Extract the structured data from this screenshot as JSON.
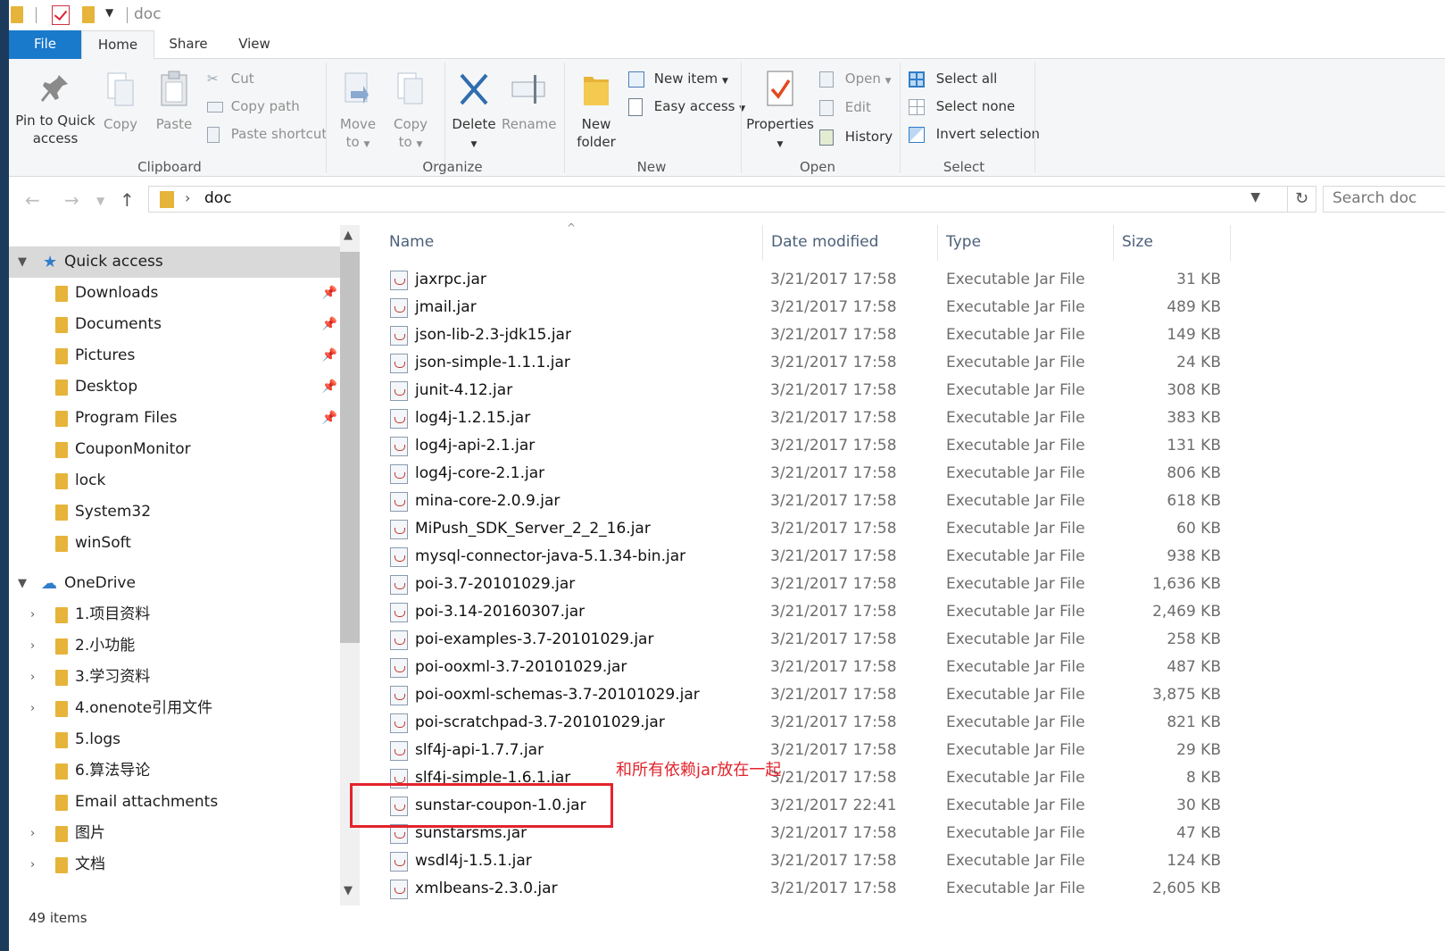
{
  "window": {
    "title": "doc"
  },
  "ribbon_tabs": [
    "File",
    "Home",
    "Share",
    "View"
  ],
  "ribbon": {
    "clipboard": {
      "group": "Clipboard",
      "pin_l1": "Pin to Quick",
      "pin_l2": "access",
      "copy": "Copy",
      "paste": "Paste",
      "cut": "Cut",
      "copy_path": "Copy path",
      "paste_shortcut": "Paste shortcut"
    },
    "organize": {
      "group": "Organize",
      "move_l1": "Move",
      "move_l2": "to",
      "copy_l1": "Copy",
      "copy_l2": "to",
      "delete": "Delete",
      "rename": "Rename"
    },
    "new": {
      "group": "New",
      "new_folder_l1": "New",
      "new_folder_l2": "folder",
      "new_item": "New item",
      "easy_access": "Easy access"
    },
    "open": {
      "group": "Open",
      "properties": "Properties",
      "open": "Open",
      "edit": "Edit",
      "history": "History"
    },
    "select": {
      "group": "Select",
      "select_all": "Select all",
      "select_none": "Select none",
      "invert_selection": "Invert selection"
    }
  },
  "address": {
    "path": "doc",
    "search_placeholder": "Search doc"
  },
  "navpane": {
    "quick_access": "Quick access",
    "quick_items": [
      {
        "label": "Downloads",
        "pinned": true
      },
      {
        "label": "Documents",
        "pinned": true
      },
      {
        "label": "Pictures",
        "pinned": true
      },
      {
        "label": "Desktop",
        "pinned": true
      },
      {
        "label": "Program Files",
        "pinned": true
      },
      {
        "label": "CouponMonitor",
        "pinned": false
      },
      {
        "label": "lock",
        "pinned": false
      },
      {
        "label": "System32",
        "pinned": false
      },
      {
        "label": "winSoft",
        "pinned": false
      }
    ],
    "onedrive": "OneDrive",
    "onedrive_items": [
      {
        "label": "1.项目资料",
        "expandable": true
      },
      {
        "label": "2.小功能",
        "expandable": true
      },
      {
        "label": "3.学习资料",
        "expandable": true
      },
      {
        "label": "4.onenote引用文件",
        "expandable": true
      },
      {
        "label": "5.logs",
        "expandable": false
      },
      {
        "label": "6.算法导论",
        "expandable": false
      },
      {
        "label": "Email attachments",
        "expandable": false
      },
      {
        "label": "图片",
        "expandable": true
      },
      {
        "label": "文档",
        "expandable": true
      }
    ]
  },
  "columns": {
    "name": "Name",
    "date": "Date modified",
    "type": "Type",
    "size": "Size"
  },
  "files": [
    {
      "name": "jaxrpc.jar",
      "date": "3/21/2017 17:58",
      "type": "Executable Jar File",
      "size": "31 KB"
    },
    {
      "name": "jmail.jar",
      "date": "3/21/2017 17:58",
      "type": "Executable Jar File",
      "size": "489 KB"
    },
    {
      "name": "json-lib-2.3-jdk15.jar",
      "date": "3/21/2017 17:58",
      "type": "Executable Jar File",
      "size": "149 KB"
    },
    {
      "name": "json-simple-1.1.1.jar",
      "date": "3/21/2017 17:58",
      "type": "Executable Jar File",
      "size": "24 KB"
    },
    {
      "name": "junit-4.12.jar",
      "date": "3/21/2017 17:58",
      "type": "Executable Jar File",
      "size": "308 KB"
    },
    {
      "name": "log4j-1.2.15.jar",
      "date": "3/21/2017 17:58",
      "type": "Executable Jar File",
      "size": "383 KB"
    },
    {
      "name": "log4j-api-2.1.jar",
      "date": "3/21/2017 17:58",
      "type": "Executable Jar File",
      "size": "131 KB"
    },
    {
      "name": "log4j-core-2.1.jar",
      "date": "3/21/2017 17:58",
      "type": "Executable Jar File",
      "size": "806 KB"
    },
    {
      "name": "mina-core-2.0.9.jar",
      "date": "3/21/2017 17:58",
      "type": "Executable Jar File",
      "size": "618 KB"
    },
    {
      "name": "MiPush_SDK_Server_2_2_16.jar",
      "date": "3/21/2017 17:58",
      "type": "Executable Jar File",
      "size": "60 KB"
    },
    {
      "name": "mysql-connector-java-5.1.34-bin.jar",
      "date": "3/21/2017 17:58",
      "type": "Executable Jar File",
      "size": "938 KB"
    },
    {
      "name": "poi-3.7-20101029.jar",
      "date": "3/21/2017 17:58",
      "type": "Executable Jar File",
      "size": "1,636 KB"
    },
    {
      "name": "poi-3.14-20160307.jar",
      "date": "3/21/2017 17:58",
      "type": "Executable Jar File",
      "size": "2,469 KB"
    },
    {
      "name": "poi-examples-3.7-20101029.jar",
      "date": "3/21/2017 17:58",
      "type": "Executable Jar File",
      "size": "258 KB"
    },
    {
      "name": "poi-ooxml-3.7-20101029.jar",
      "date": "3/21/2017 17:58",
      "type": "Executable Jar File",
      "size": "487 KB"
    },
    {
      "name": "poi-ooxml-schemas-3.7-20101029.jar",
      "date": "3/21/2017 17:58",
      "type": "Executable Jar File",
      "size": "3,875 KB"
    },
    {
      "name": "poi-scratchpad-3.7-20101029.jar",
      "date": "3/21/2017 17:58",
      "type": "Executable Jar File",
      "size": "821 KB"
    },
    {
      "name": "slf4j-api-1.7.7.jar",
      "date": "3/21/2017 17:58",
      "type": "Executable Jar File",
      "size": "29 KB"
    },
    {
      "name": "slf4j-simple-1.6.1.jar",
      "date": "3/21/2017 17:58",
      "type": "Executable Jar File",
      "size": "8 KB"
    },
    {
      "name": "sunstar-coupon-1.0.jar",
      "date": "3/21/2017 22:41",
      "type": "Executable Jar File",
      "size": "30 KB"
    },
    {
      "name": "sunstarsms.jar",
      "date": "3/21/2017 17:58",
      "type": "Executable Jar File",
      "size": "47 KB"
    },
    {
      "name": "wsdl4j-1.5.1.jar",
      "date": "3/21/2017 17:58",
      "type": "Executable Jar File",
      "size": "124 KB"
    },
    {
      "name": "xmlbeans-2.3.0.jar",
      "date": "3/21/2017 17:58",
      "type": "Executable Jar File",
      "size": "2,605 KB"
    }
  ],
  "annotation": {
    "text": "和所有依赖jar放在一起",
    "color": "#e3232b"
  },
  "status": {
    "items": "49 items"
  },
  "colors": {
    "accent": "#1979ca",
    "folder": "#e6b43a",
    "header_text": "#4c607a"
  }
}
